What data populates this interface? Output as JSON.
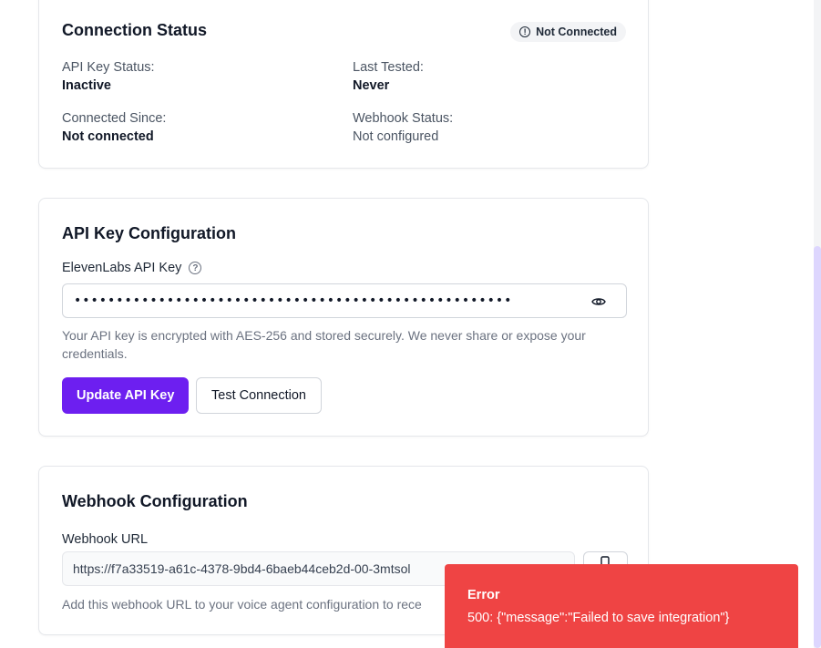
{
  "connection_status": {
    "title": "Connection Status",
    "badge": "Not Connected",
    "badge_icon": "alert-circle-icon",
    "fields": [
      {
        "label": "API Key Status:",
        "value": "Inactive"
      },
      {
        "label": "Last Tested:",
        "value": "Never"
      },
      {
        "label": "Connected Since:",
        "value": "Not connected"
      },
      {
        "label": "Webhook Status:",
        "value": "Not configured"
      }
    ]
  },
  "api_config": {
    "title": "API Key Configuration",
    "input_label": "ElevenLabs API Key",
    "api_key_masked": "••••••••••••••••••••••••••••••••••••••••••••••••••••",
    "helper": "Your API key is encrypted with AES-256 and stored securely. We never share or expose your credentials.",
    "update_button": "Update API Key",
    "test_button": "Test Connection"
  },
  "webhook_config": {
    "title": "Webhook Configuration",
    "input_label": "Webhook URL",
    "url": "https://f7a33519-a61c-4378-9bd4-6baeb44ceb2d-00-3mtsol",
    "helper": "Add this webhook URL to your voice agent configuration to rece"
  },
  "toast": {
    "title": "Error",
    "message": "500: {\"message\":\"Failed to save integration\"}"
  },
  "colors": {
    "primary": "#6d1ff0",
    "error": "#ef4444",
    "scrollbar_thumb": "#ddd6fe"
  }
}
